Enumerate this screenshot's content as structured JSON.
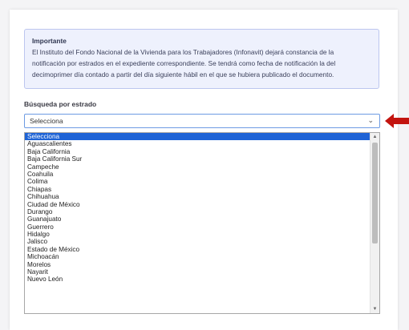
{
  "notice": {
    "title": "Importante",
    "line1": "El Instituto del Fondo Nacional de la Vivienda para los Trabajadores (Infonavit) dejará constancia de la",
    "line2": "notificación por estrados en el expediente correspondiente. Se tendrá como fecha de notificación la del",
    "line3": "decimoprimer día contado a partir del día siguiente hábil en el que se hubiera publicado el documento."
  },
  "search": {
    "label": "Búsqueda por estrado",
    "selected": "Selecciona",
    "chevron": "⌄"
  },
  "dropdown": {
    "options": [
      "Selecciona",
      "Aguascalientes",
      "Baja California",
      "Baja California Sur",
      "Campeche",
      "Coahuila",
      "Colima",
      "Chiapas",
      "Chihuahua",
      "Ciudad de México",
      "Durango",
      "Guanajuato",
      "Guerrero",
      "Hidalgo",
      "Jalisco",
      "Estado de México",
      "Michoacán",
      "Morelos",
      "Nayarit",
      "Nuevo León"
    ],
    "selected_index": 0,
    "scroll_position": 0.0
  },
  "colors": {
    "arrow": "#c3140f",
    "highlight": "#1e63d6",
    "notice_bg": "#eef1fd"
  },
  "icons": {
    "chevron": "chevron-down-icon",
    "arrow": "red-arrow-left-icon"
  }
}
